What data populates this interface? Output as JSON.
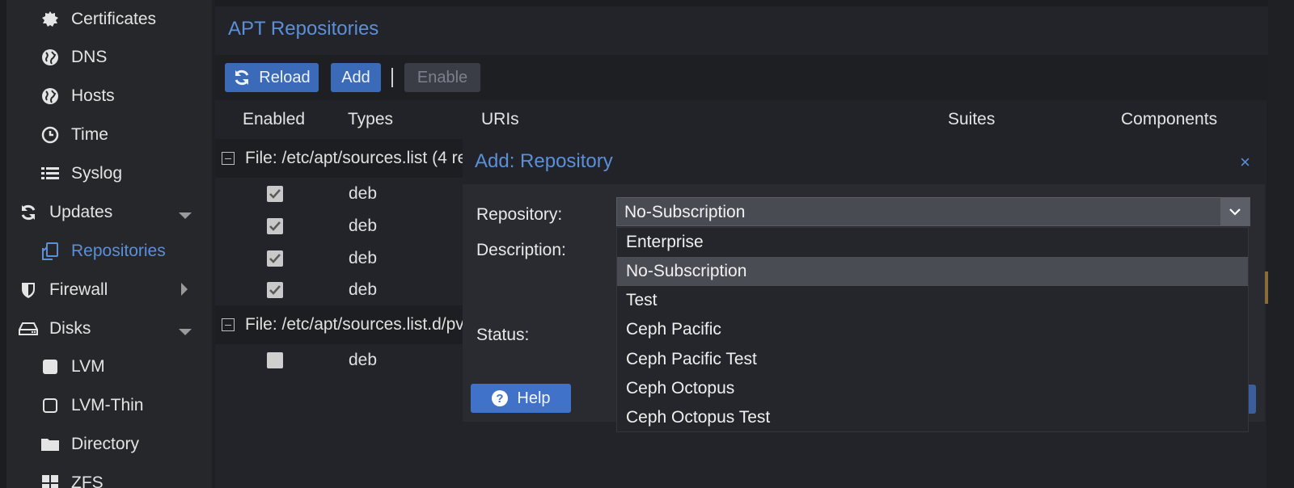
{
  "sidebar": {
    "items": [
      {
        "label": "Certificates",
        "icon": "certificate-icon"
      },
      {
        "label": "DNS",
        "icon": "globe-icon"
      },
      {
        "label": "Hosts",
        "icon": "globe-icon"
      },
      {
        "label": "Time",
        "icon": "clock-icon"
      },
      {
        "label": "Syslog",
        "icon": "list-icon"
      },
      {
        "label": "Updates",
        "icon": "refresh-icon"
      },
      {
        "label": "Repositories",
        "icon": "files-icon"
      },
      {
        "label": "Firewall",
        "icon": "shield-icon"
      },
      {
        "label": "Disks",
        "icon": "hdd-icon"
      },
      {
        "label": "LVM",
        "icon": "square-icon"
      },
      {
        "label": "LVM-Thin",
        "icon": "square-outline-icon"
      },
      {
        "label": "Directory",
        "icon": "folder-icon"
      },
      {
        "label": "ZFS",
        "icon": "grid-icon"
      }
    ]
  },
  "panel": {
    "title": "APT Repositories",
    "toolbar": {
      "reload": "Reload",
      "add": "Add",
      "enable": "Enable"
    },
    "columns": {
      "enabled": "Enabled",
      "types": "Types",
      "uris": "URIs",
      "suites": "Suites",
      "components": "Components"
    },
    "groups": [
      {
        "label": "File: /etc/apt/sources.list (4 re",
        "rows": [
          {
            "enabled": true,
            "type": "deb"
          },
          {
            "enabled": true,
            "type": "deb"
          },
          {
            "enabled": true,
            "type": "deb"
          },
          {
            "enabled": true,
            "type": "deb"
          }
        ]
      },
      {
        "label": "File: /etc/apt/sources.list.d/pv",
        "rows": [
          {
            "enabled": false,
            "type": "deb"
          }
        ]
      }
    ]
  },
  "dialog": {
    "title": "Add: Repository",
    "close": "×",
    "labels": {
      "repository": "Repository:",
      "description": "Description:",
      "status": "Status:"
    },
    "repository_value": "No-Subscription",
    "help": "Help",
    "options": [
      "Enterprise",
      "No-Subscription",
      "Test",
      "Ceph Pacific",
      "Ceph Pacific Test",
      "Ceph Octopus",
      "Ceph Octopus Test"
    ],
    "selected_option": "No-Subscription"
  },
  "colors": {
    "accent": "#5b8fd8",
    "primary_button": "#3b6ab8",
    "help_button": "#3f72c8"
  }
}
